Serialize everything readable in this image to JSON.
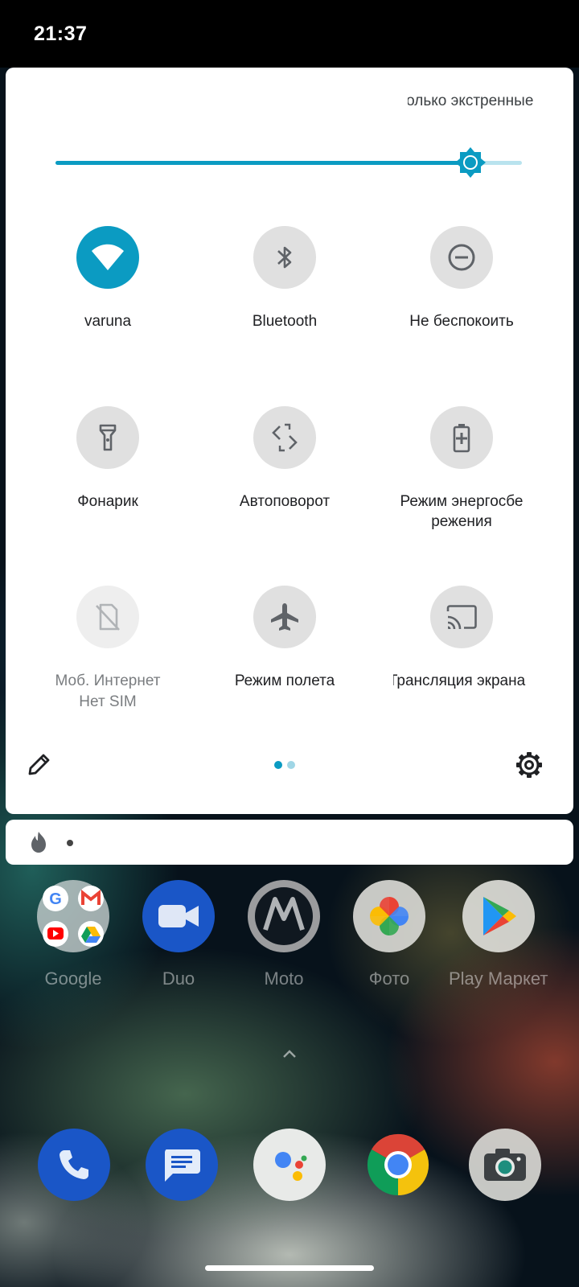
{
  "status_bar": {
    "time": "21:37"
  },
  "quick_settings": {
    "dnd_banner": "Только экстренные",
    "brightness": {
      "level": 0.89
    },
    "tiles": [
      {
        "id": "wifi",
        "label": "varuna",
        "icon": "wifi-icon",
        "active": true
      },
      {
        "id": "bluetooth",
        "label": "Bluetooth",
        "icon": "bluetooth-icon",
        "active": false
      },
      {
        "id": "dnd",
        "label": "Не беспокоить",
        "icon": "do-not-disturb-icon",
        "active": false
      },
      {
        "id": "flashlight",
        "label": "Фонарик",
        "icon": "flashlight-icon",
        "active": false
      },
      {
        "id": "autorotate",
        "label": "Автоповорот",
        "icon": "auto-rotate-icon",
        "active": false
      },
      {
        "id": "battery_saver",
        "label": "Режим энергосбе режения",
        "icon": "battery-saver-icon",
        "active": false
      },
      {
        "id": "mobile_data",
        "label": "Моб. Интернет",
        "sublabel": "Нет SIM",
        "icon": "no-sim-icon",
        "active": false,
        "disabled": true
      },
      {
        "id": "airplane",
        "label": "Режим полета",
        "icon": "airplane-icon",
        "active": false
      },
      {
        "id": "cast",
        "label": "Трансляция экрана",
        "icon": "cast-icon",
        "active": false
      }
    ],
    "page_indicator": {
      "pages": 2,
      "current": 1
    },
    "footer": {
      "edit_icon": "pencil-icon",
      "settings_icon": "gear-icon"
    }
  },
  "notification": {
    "app_icon": "fire-icon"
  },
  "home_apps": [
    {
      "name": "Google",
      "icon": "google-folder-icon"
    },
    {
      "name": "Duo",
      "icon": "duo-icon"
    },
    {
      "name": "Moto",
      "icon": "moto-icon"
    },
    {
      "name": "Фото",
      "icon": "photos-icon"
    },
    {
      "name": "Play Маркет",
      "icon": "play-store-icon"
    }
  ],
  "dock": [
    {
      "name": "phone",
      "icon": "phone-icon"
    },
    {
      "name": "messages",
      "icon": "messages-icon"
    },
    {
      "name": "assistant",
      "icon": "assistant-icon"
    },
    {
      "name": "chrome",
      "icon": "chrome-icon"
    },
    {
      "name": "camera",
      "icon": "camera-icon"
    }
  ],
  "colors": {
    "accent": "#0b9bc2",
    "tile_off": "#e0e0e0",
    "panel": "#ffffff"
  }
}
